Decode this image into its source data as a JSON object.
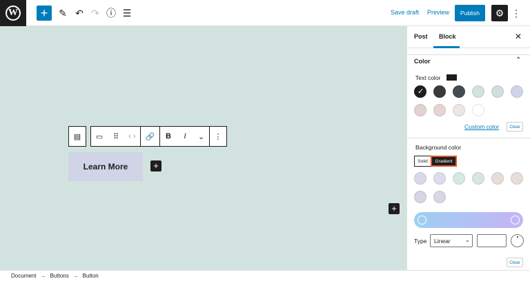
{
  "topbar": {
    "logo_letter": "W",
    "add_icon": "plus-icon",
    "save_draft": "Save draft",
    "preview": "Preview",
    "publish": "Publish"
  },
  "canvas": {
    "button_text": "Learn More",
    "background": "#d2e3df",
    "button_bg": "#d1d3e6"
  },
  "toolbar": {
    "bold": "B",
    "italic": "I"
  },
  "sidebar": {
    "tabs": {
      "post": "Post",
      "block": "Block"
    },
    "color_section": "Color",
    "text_color_label": "Text color",
    "text_swatches": [
      "#1e1e1e",
      "#3a3a3a",
      "#444b53",
      "#d2e3df",
      "#d0dede",
      "#d1d3e6",
      "#e2d3d2",
      "#e4d5d3",
      "#ede6e2",
      "#ffffff"
    ],
    "custom_color": "Custom color",
    "clear": "Clear",
    "background_color_label": "Background color",
    "seg_solid": "Solid",
    "seg_gradient": "Gradient",
    "gradient_swatches": [
      "#d8dae8",
      "#dcdcf0",
      "#d6e8e4",
      "#d7e6de",
      "#e6dcd8",
      "#e7dddb",
      "#d8d4e4",
      "#dbd6e6"
    ],
    "type_label": "Type",
    "type_value": "Linear",
    "gradient_start": "#9ecff2",
    "gradient_end": "#c5b4f6"
  },
  "footer": {
    "crumbs": [
      "Document",
      "Buttons",
      "Button"
    ],
    "separator": "→"
  }
}
